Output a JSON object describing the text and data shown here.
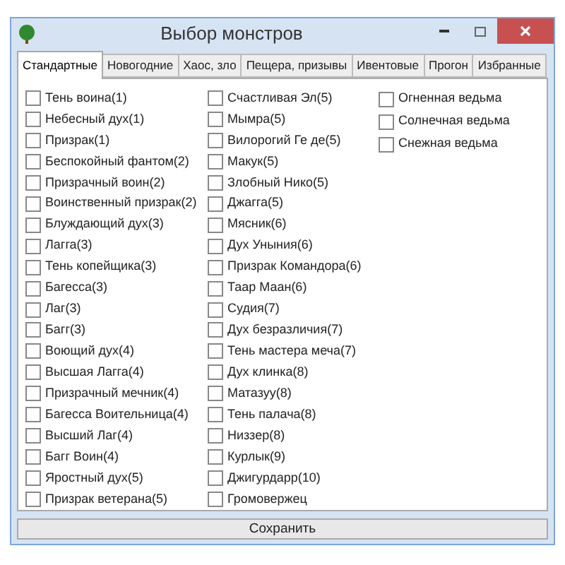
{
  "window": {
    "title": "Выбор монстров"
  },
  "tabs": [
    {
      "label": "Стандартные",
      "selected": true
    },
    {
      "label": "Новогодние",
      "selected": false
    },
    {
      "label": "Хаос, зло",
      "selected": false
    },
    {
      "label": "Пещера, призывы",
      "selected": false
    },
    {
      "label": "Ивентовые",
      "selected": false
    },
    {
      "label": "Прогон",
      "selected": false
    },
    {
      "label": "Избранные",
      "selected": false
    }
  ],
  "columns": [
    [
      {
        "label": "Тень воина(1)",
        "checked": false
      },
      {
        "label": "Небесный дух(1)",
        "checked": false
      },
      {
        "label": "Призрак(1)",
        "checked": false
      },
      {
        "label": "Беспокойный фантом(2)",
        "checked": false
      },
      {
        "label": "Призрачный воин(2)",
        "checked": false
      },
      {
        "label": "Воинственный призрак(2)",
        "checked": false
      },
      {
        "label": "Блуждающий дух(3)",
        "checked": false
      },
      {
        "label": "Лагга(3)",
        "checked": false
      },
      {
        "label": "Тень копейщика(3)",
        "checked": false
      },
      {
        "label": "Багесса(3)",
        "checked": false
      },
      {
        "label": "Лаг(3)",
        "checked": false
      },
      {
        "label": "Багг(3)",
        "checked": false
      },
      {
        "label": "Воющий дух(4)",
        "checked": false
      },
      {
        "label": "Высшая Лагга(4)",
        "checked": false
      },
      {
        "label": "Призрачный мечник(4)",
        "checked": false
      },
      {
        "label": "Багесса Воительница(4)",
        "checked": false
      },
      {
        "label": "Высший Лаг(4)",
        "checked": false
      },
      {
        "label": "Багг Воин(4)",
        "checked": false
      },
      {
        "label": "Яростный дух(5)",
        "checked": false
      },
      {
        "label": "Призрак ветерана(5)",
        "checked": false
      }
    ],
    [
      {
        "label": "Счастливая Эл(5)",
        "checked": false
      },
      {
        "label": "Мымра(5)",
        "checked": false
      },
      {
        "label": "Вилорогий Ге де(5)",
        "checked": false
      },
      {
        "label": "Макук(5)",
        "checked": false
      },
      {
        "label": "Злобный Нико(5)",
        "checked": false
      },
      {
        "label": "Джагга(5)",
        "checked": false
      },
      {
        "label": "Мясник(6)",
        "checked": false
      },
      {
        "label": "Дух Уныния(6)",
        "checked": false
      },
      {
        "label": "Призрак Командора(6)",
        "checked": false
      },
      {
        "label": "Таар Маан(6)",
        "checked": false
      },
      {
        "label": "Судия(7)",
        "checked": false
      },
      {
        "label": "Дух безразличия(7)",
        "checked": false
      },
      {
        "label": "Тень мастера меча(7)",
        "checked": false
      },
      {
        "label": "Дух клинка(8)",
        "checked": false
      },
      {
        "label": "Матазуу(8)",
        "checked": false
      },
      {
        "label": "Тень палача(8)",
        "checked": false
      },
      {
        "label": "Низзер(8)",
        "checked": false
      },
      {
        "label": "Курлык(9)",
        "checked": false
      },
      {
        "label": "Джигурдарр(10)",
        "checked": false
      },
      {
        "label": "Громовержец",
        "checked": false
      }
    ],
    [
      {
        "label": "Огненная ведьма",
        "checked": false
      },
      {
        "label": "Солнечная ведьма",
        "checked": false
      },
      {
        "label": "Снежная ведьма",
        "checked": false
      }
    ]
  ],
  "save_button": "Сохранить"
}
